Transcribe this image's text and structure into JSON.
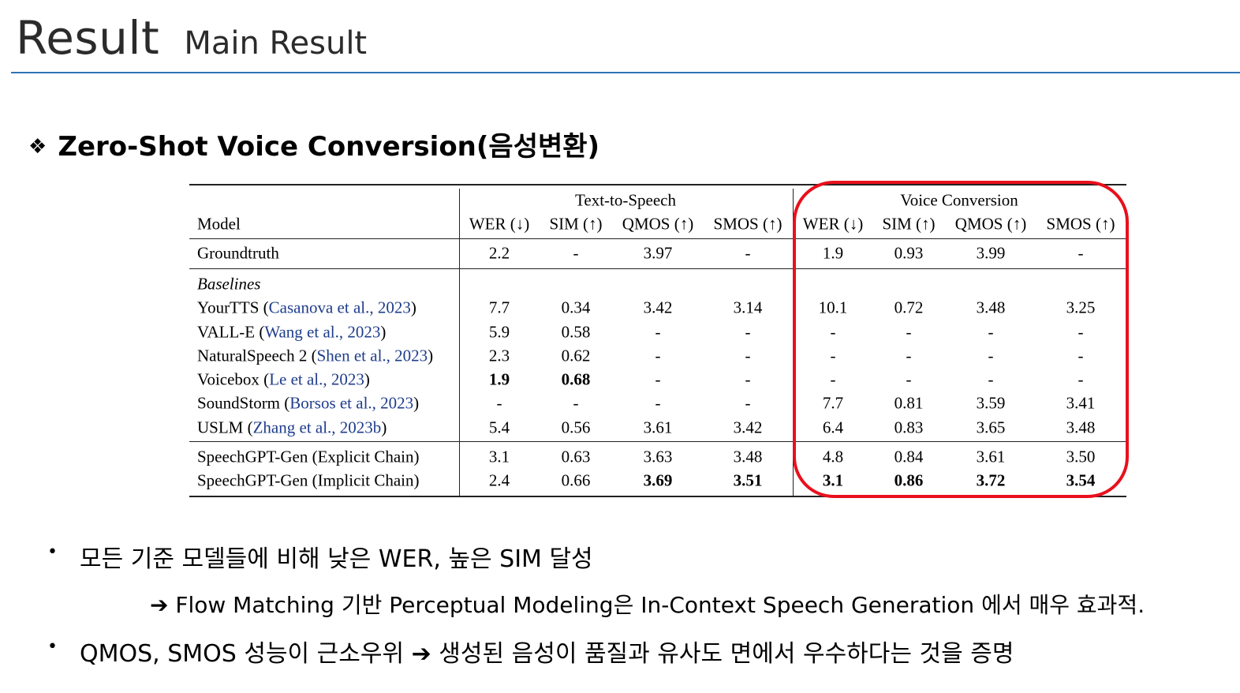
{
  "title": {
    "main": "Result",
    "sub": "Main Result"
  },
  "section": {
    "bullet": "❖",
    "heading": "Zero-Shot Voice Conversion(음성변환)"
  },
  "table": {
    "groups": [
      "Text-to-Speech",
      "Voice Conversion"
    ],
    "model_header": "Model",
    "metrics": [
      "WER (↓)",
      "SIM (↑)",
      "QMOS (↑)",
      "SMOS (↑)",
      "WER (↓)",
      "SIM (↑)",
      "QMOS (↑)",
      "SMOS (↑)"
    ],
    "baselines_label": "Baselines",
    "rows": [
      {
        "name": "Groundtruth",
        "cite": "",
        "values": [
          "2.2",
          "-",
          "3.97",
          "-",
          "1.9",
          "0.93",
          "3.99",
          "-"
        ],
        "bold": []
      },
      {
        "name": "YourTTS (",
        "cite": "Casanova et al., 2023",
        "close": ")",
        "values": [
          "7.7",
          "0.34",
          "3.42",
          "3.14",
          "10.1",
          "0.72",
          "3.48",
          "3.25"
        ],
        "bold": []
      },
      {
        "name": "VALL-E (",
        "cite": "Wang et al., 2023",
        "close": ")",
        "values": [
          "5.9",
          "0.58",
          "-",
          "-",
          "-",
          "-",
          "-",
          "-"
        ],
        "bold": []
      },
      {
        "name": "NaturalSpeech 2 (",
        "cite": "Shen et al., 2023",
        "close": ")",
        "values": [
          "2.3",
          "0.62",
          "-",
          "-",
          "-",
          "-",
          "-",
          "-"
        ],
        "bold": []
      },
      {
        "name": "Voicebox (",
        "cite": "Le et al., 2023",
        "close": ")",
        "values": [
          "1.9",
          "0.68",
          "-",
          "-",
          "-",
          "-",
          "-",
          "-"
        ],
        "bold": [
          0,
          1
        ]
      },
      {
        "name": "SoundStorm (",
        "cite": "Borsos et al., 2023",
        "close": ")",
        "values": [
          "-",
          "-",
          "-",
          "-",
          "7.7",
          "0.81",
          "3.59",
          "3.41"
        ],
        "bold": []
      },
      {
        "name": "USLM (",
        "cite": "Zhang et al., 2023b",
        "close": ")",
        "values": [
          "5.4",
          "0.56",
          "3.61",
          "3.42",
          "6.4",
          "0.83",
          "3.65",
          "3.48"
        ],
        "bold": []
      },
      {
        "name": "SpeechGPT-Gen (Explicit Chain)",
        "cite": "",
        "values": [
          "3.1",
          "0.63",
          "3.63",
          "3.48",
          "4.8",
          "0.84",
          "3.61",
          "3.50"
        ],
        "bold": []
      },
      {
        "name": "SpeechGPT-Gen (Implicit Chain)",
        "cite": "",
        "values": [
          "2.4",
          "0.66",
          "3.69",
          "3.51",
          "3.1",
          "0.86",
          "3.72",
          "3.54"
        ],
        "bold": [
          2,
          3,
          4,
          5,
          6,
          7
        ]
      }
    ]
  },
  "bullets": {
    "item1": "모든 기준 모델들에 비해 낮은 WER, 높은 SIM 달성",
    "sub1": "➔ Flow Matching 기반 Perceptual Modeling은 In-Context Speech Generation 에서 매우 효과적.",
    "item2": "QMOS, SMOS 성능이 근소우위 ➔ 생성된 음성이 품질과 유사도 면에서 우수하다는 것을 증명",
    "dot": "•"
  },
  "colors": {
    "title_rule": "#2e74b5",
    "highlight_box": "#e8101c",
    "citation": "#1f3d8c"
  }
}
